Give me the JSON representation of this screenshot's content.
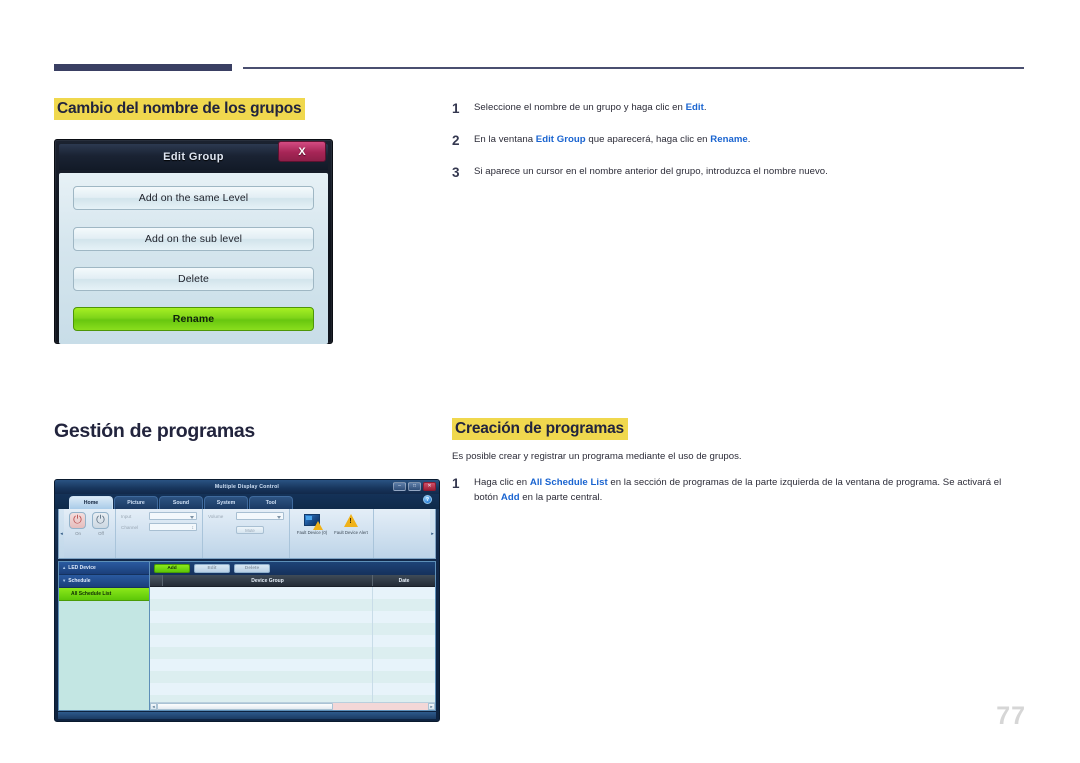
{
  "page": {
    "number": "77"
  },
  "colors": {
    "highlight": "#f0d84e",
    "heading_text": "#22243d",
    "link_bold": "#1a64d0",
    "rule": "#3a3f63",
    "accent_green": "#7ed41a"
  },
  "section_rename": {
    "heading": "Cambio del nombre de los grupos",
    "steps": [
      {
        "num": "1",
        "parts": [
          {
            "t": "Seleccione el nombre de un grupo y haga clic en ",
            "b": false
          },
          {
            "t": "Edit",
            "b": true
          },
          {
            "t": ".",
            "b": false
          }
        ]
      },
      {
        "num": "2",
        "parts": [
          {
            "t": "En la ventana ",
            "b": false
          },
          {
            "t": "Edit Group",
            "b": true
          },
          {
            "t": " que aparecerá, haga clic en ",
            "b": false
          },
          {
            "t": "Rename",
            "b": true
          },
          {
            "t": ".",
            "b": false
          }
        ]
      },
      {
        "num": "3",
        "parts": [
          {
            "t": "Si aparece un cursor en el nombre anterior del grupo, introduzca el nombre nuevo.",
            "b": false
          }
        ]
      }
    ]
  },
  "edit_group_dialog": {
    "title": "Edit Group",
    "close_label": "X",
    "buttons": [
      {
        "label": "Add on the same Level",
        "state": "normal"
      },
      {
        "label": "Add on the sub level",
        "state": "normal"
      },
      {
        "label": "Delete",
        "state": "normal"
      },
      {
        "label": "Rename",
        "state": "highlighted"
      }
    ]
  },
  "section_schedule": {
    "heading": "Gestión de programas",
    "sub_heading": "Creación de programas",
    "intro": "Es posible crear y registrar un programa mediante el uso de grupos.",
    "steps": [
      {
        "num": "1",
        "parts": [
          {
            "t": "Haga clic en ",
            "b": false
          },
          {
            "t": "All Schedule List",
            "b": true
          },
          {
            "t": " en la sección de programas de la parte izquierda de la ventana de programa. Se activará el botón ",
            "b": false
          },
          {
            "t": "Add",
            "b": true
          },
          {
            "t": " en la parte central.",
            "b": false
          }
        ]
      }
    ]
  },
  "mdc_app": {
    "window_title": "Multiple Display Control",
    "window_controls": [
      {
        "name": "minimize",
        "glyph": "–"
      },
      {
        "name": "maximize",
        "glyph": "□"
      },
      {
        "name": "close",
        "glyph": "✕"
      }
    ],
    "help_icon_label": "?",
    "tabs": [
      {
        "label": "Home",
        "active": true
      },
      {
        "label": "Picture",
        "active": false
      },
      {
        "label": "Sound",
        "active": false
      },
      {
        "label": "System",
        "active": false
      },
      {
        "label": "Tool",
        "active": false
      }
    ],
    "ribbon": {
      "power": [
        {
          "label": "On",
          "state": "on"
        },
        {
          "label": "Off",
          "state": "off"
        }
      ],
      "fields": [
        {
          "label": "Input",
          "type": "dropdown",
          "value": ""
        },
        {
          "label": "Channel",
          "type": "spinner",
          "value": ""
        },
        {
          "label": "Volume",
          "type": "slider",
          "value": ""
        }
      ],
      "mute_label": "Mute",
      "icons": [
        {
          "label": "Fault Device (0)",
          "icon": "monitor-warning-icon"
        },
        {
          "label": "Fault Device Alert",
          "icon": "warning-triangle-icon"
        }
      ]
    },
    "sidebar": [
      {
        "label": "LED Device",
        "type": "header",
        "arrow": "▴"
      },
      {
        "label": "Schedule",
        "type": "header",
        "arrow": "▾"
      },
      {
        "label": "All Schedule List",
        "type": "selected"
      }
    ],
    "toolbar_buttons": [
      {
        "label": "Add",
        "enabled": true
      },
      {
        "label": "Edit",
        "enabled": false
      },
      {
        "label": "Delete",
        "enabled": false
      }
    ],
    "table": {
      "columns": [
        "",
        "Device Group",
        "Date"
      ],
      "rows": []
    }
  }
}
